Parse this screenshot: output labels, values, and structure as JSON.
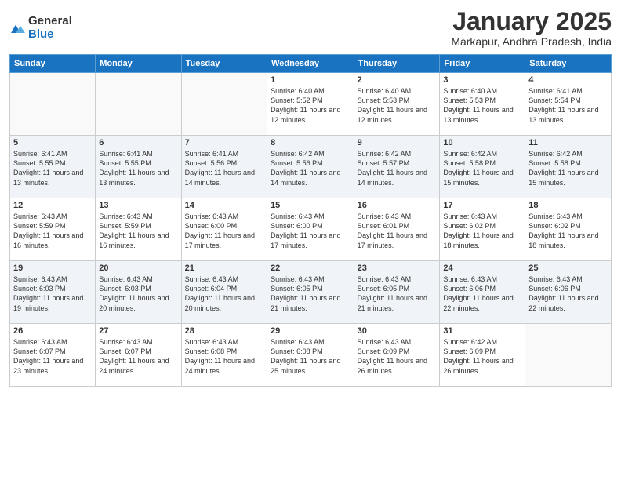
{
  "logo": {
    "general": "General",
    "blue": "Blue"
  },
  "title": "January 2025",
  "location": "Markapur, Andhra Pradesh, India",
  "days_of_week": [
    "Sunday",
    "Monday",
    "Tuesday",
    "Wednesday",
    "Thursday",
    "Friday",
    "Saturday"
  ],
  "weeks": [
    [
      {
        "day": "",
        "info": ""
      },
      {
        "day": "",
        "info": ""
      },
      {
        "day": "",
        "info": ""
      },
      {
        "day": "1",
        "info": "Sunrise: 6:40 AM\nSunset: 5:52 PM\nDaylight: 11 hours and 12 minutes."
      },
      {
        "day": "2",
        "info": "Sunrise: 6:40 AM\nSunset: 5:53 PM\nDaylight: 11 hours and 12 minutes."
      },
      {
        "day": "3",
        "info": "Sunrise: 6:40 AM\nSunset: 5:53 PM\nDaylight: 11 hours and 13 minutes."
      },
      {
        "day": "4",
        "info": "Sunrise: 6:41 AM\nSunset: 5:54 PM\nDaylight: 11 hours and 13 minutes."
      }
    ],
    [
      {
        "day": "5",
        "info": "Sunrise: 6:41 AM\nSunset: 5:55 PM\nDaylight: 11 hours and 13 minutes."
      },
      {
        "day": "6",
        "info": "Sunrise: 6:41 AM\nSunset: 5:55 PM\nDaylight: 11 hours and 13 minutes."
      },
      {
        "day": "7",
        "info": "Sunrise: 6:41 AM\nSunset: 5:56 PM\nDaylight: 11 hours and 14 minutes."
      },
      {
        "day": "8",
        "info": "Sunrise: 6:42 AM\nSunset: 5:56 PM\nDaylight: 11 hours and 14 minutes."
      },
      {
        "day": "9",
        "info": "Sunrise: 6:42 AM\nSunset: 5:57 PM\nDaylight: 11 hours and 14 minutes."
      },
      {
        "day": "10",
        "info": "Sunrise: 6:42 AM\nSunset: 5:58 PM\nDaylight: 11 hours and 15 minutes."
      },
      {
        "day": "11",
        "info": "Sunrise: 6:42 AM\nSunset: 5:58 PM\nDaylight: 11 hours and 15 minutes."
      }
    ],
    [
      {
        "day": "12",
        "info": "Sunrise: 6:43 AM\nSunset: 5:59 PM\nDaylight: 11 hours and 16 minutes."
      },
      {
        "day": "13",
        "info": "Sunrise: 6:43 AM\nSunset: 5:59 PM\nDaylight: 11 hours and 16 minutes."
      },
      {
        "day": "14",
        "info": "Sunrise: 6:43 AM\nSunset: 6:00 PM\nDaylight: 11 hours and 17 minutes."
      },
      {
        "day": "15",
        "info": "Sunrise: 6:43 AM\nSunset: 6:00 PM\nDaylight: 11 hours and 17 minutes."
      },
      {
        "day": "16",
        "info": "Sunrise: 6:43 AM\nSunset: 6:01 PM\nDaylight: 11 hours and 17 minutes."
      },
      {
        "day": "17",
        "info": "Sunrise: 6:43 AM\nSunset: 6:02 PM\nDaylight: 11 hours and 18 minutes."
      },
      {
        "day": "18",
        "info": "Sunrise: 6:43 AM\nSunset: 6:02 PM\nDaylight: 11 hours and 18 minutes."
      }
    ],
    [
      {
        "day": "19",
        "info": "Sunrise: 6:43 AM\nSunset: 6:03 PM\nDaylight: 11 hours and 19 minutes."
      },
      {
        "day": "20",
        "info": "Sunrise: 6:43 AM\nSunset: 6:03 PM\nDaylight: 11 hours and 20 minutes."
      },
      {
        "day": "21",
        "info": "Sunrise: 6:43 AM\nSunset: 6:04 PM\nDaylight: 11 hours and 20 minutes."
      },
      {
        "day": "22",
        "info": "Sunrise: 6:43 AM\nSunset: 6:05 PM\nDaylight: 11 hours and 21 minutes."
      },
      {
        "day": "23",
        "info": "Sunrise: 6:43 AM\nSunset: 6:05 PM\nDaylight: 11 hours and 21 minutes."
      },
      {
        "day": "24",
        "info": "Sunrise: 6:43 AM\nSunset: 6:06 PM\nDaylight: 11 hours and 22 minutes."
      },
      {
        "day": "25",
        "info": "Sunrise: 6:43 AM\nSunset: 6:06 PM\nDaylight: 11 hours and 22 minutes."
      }
    ],
    [
      {
        "day": "26",
        "info": "Sunrise: 6:43 AM\nSunset: 6:07 PM\nDaylight: 11 hours and 23 minutes."
      },
      {
        "day": "27",
        "info": "Sunrise: 6:43 AM\nSunset: 6:07 PM\nDaylight: 11 hours and 24 minutes."
      },
      {
        "day": "28",
        "info": "Sunrise: 6:43 AM\nSunset: 6:08 PM\nDaylight: 11 hours and 24 minutes."
      },
      {
        "day": "29",
        "info": "Sunrise: 6:43 AM\nSunset: 6:08 PM\nDaylight: 11 hours and 25 minutes."
      },
      {
        "day": "30",
        "info": "Sunrise: 6:43 AM\nSunset: 6:09 PM\nDaylight: 11 hours and 26 minutes."
      },
      {
        "day": "31",
        "info": "Sunrise: 6:42 AM\nSunset: 6:09 PM\nDaylight: 11 hours and 26 minutes."
      },
      {
        "day": "",
        "info": ""
      }
    ]
  ]
}
